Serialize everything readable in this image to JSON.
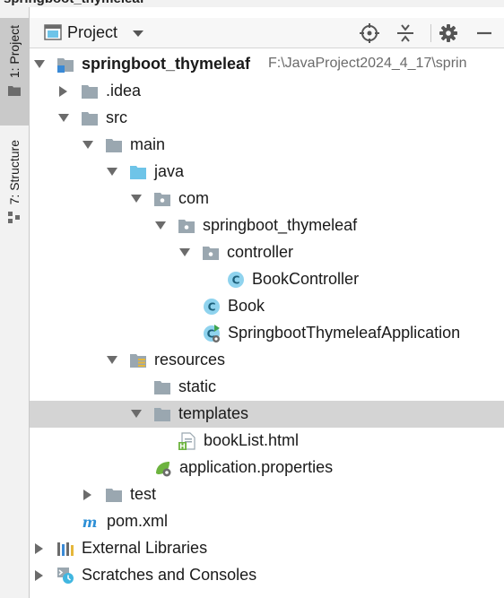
{
  "window": {
    "title_fragment": "springboot_thymeleaf"
  },
  "sidebar": {
    "tabs": [
      {
        "label": "1: Project",
        "active": true,
        "icon": "folder-icon"
      },
      {
        "label": "7: Structure",
        "active": false,
        "icon": "structure-icon"
      }
    ]
  },
  "header": {
    "title": "Project",
    "dropdown_icon": "chevron-down-icon",
    "buttons": [
      "locate-icon",
      "collapse-all-icon",
      "gear-icon",
      "minimize-icon"
    ]
  },
  "colors": {
    "folder": "#9aa7b0",
    "source_folder": "#6ec4e8",
    "class_icon": "#40b6e0",
    "selected_row": "#d4d4d4",
    "maven": "#2d8fd6",
    "spring": "#6db33f"
  },
  "tree": [
    {
      "label": "springboot_thymeleaf",
      "path": "F:\\JavaProject2024_4_17\\sprin",
      "bold": true,
      "icon": "module-icon",
      "arrow": "down"
    },
    {
      "label": ".idea",
      "icon": "folder-icon",
      "arrow": "right"
    },
    {
      "label": "src",
      "icon": "folder-icon",
      "arrow": "down"
    },
    {
      "label": "main",
      "icon": "folder-icon",
      "arrow": "down"
    },
    {
      "label": "java",
      "icon": "source-folder-icon",
      "arrow": "down"
    },
    {
      "label": "com",
      "icon": "package-icon",
      "arrow": "down"
    },
    {
      "label": "springboot_thymeleaf",
      "icon": "package-icon",
      "arrow": "down"
    },
    {
      "label": "controller",
      "icon": "package-icon",
      "arrow": "down"
    },
    {
      "label": "BookController",
      "icon": "class-icon"
    },
    {
      "label": "Book",
      "icon": "class-icon"
    },
    {
      "label": "SpringbootThymeleafApplication",
      "icon": "spring-boot-class-icon"
    },
    {
      "label": "resources",
      "icon": "resources-folder-icon",
      "arrow": "down"
    },
    {
      "label": "static",
      "icon": "folder-icon"
    },
    {
      "label": "templates",
      "icon": "folder-icon",
      "arrow": "down",
      "selected": true
    },
    {
      "label": "bookList.html",
      "icon": "html-file-icon"
    },
    {
      "label": "application.properties",
      "icon": "spring-properties-icon"
    },
    {
      "label": "test",
      "icon": "folder-icon",
      "arrow": "right"
    },
    {
      "label": "pom.xml",
      "icon": "maven-icon"
    },
    {
      "label": "External Libraries",
      "icon": "libraries-icon",
      "arrow": "right"
    },
    {
      "label": "Scratches and Consoles",
      "icon": "scratches-icon",
      "arrow": "right"
    }
  ]
}
